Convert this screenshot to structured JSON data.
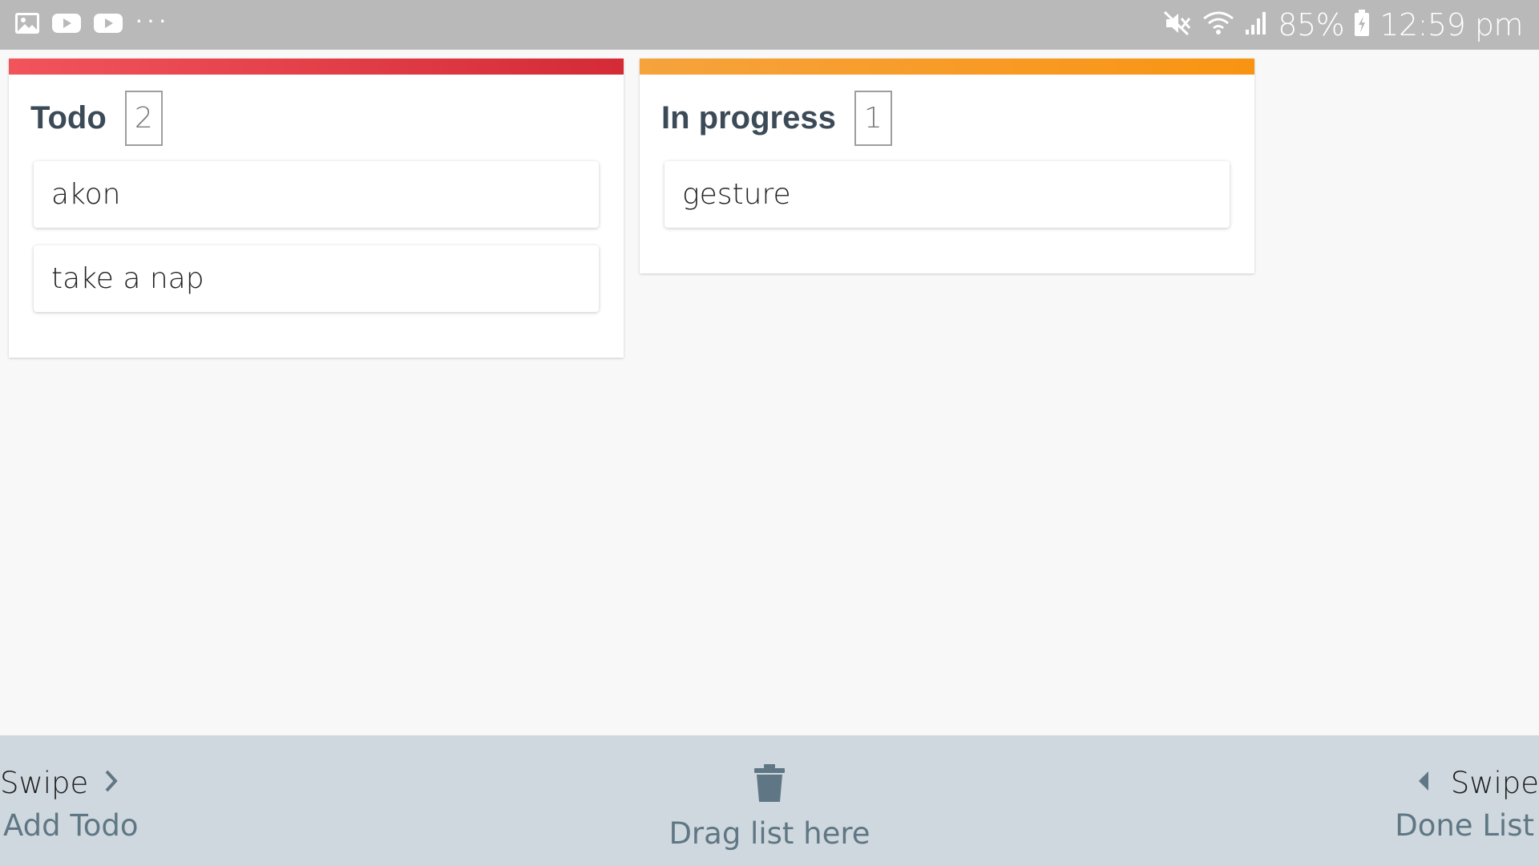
{
  "status_bar": {
    "battery": "85%",
    "time": "12:59 pm",
    "left_icons": [
      "gallery-icon",
      "youtube-icon",
      "youtube-icon",
      "more-notifications-icon"
    ],
    "right_icons": [
      "mute-icon",
      "wifi-icon",
      "signal-icon",
      "battery-charging-icon"
    ],
    "overflow_dots": "···"
  },
  "board": {
    "columns": [
      {
        "title": "Todo",
        "count": "2",
        "accent": "#e23a45",
        "cards": [
          "akon",
          "take a nap"
        ]
      },
      {
        "title": "In progress",
        "count": "1",
        "accent": "#f89a22",
        "cards": [
          "gesture"
        ]
      }
    ]
  },
  "bottom_bar": {
    "left_swipe": {
      "hint": "Swipe",
      "action": "Add Todo"
    },
    "delete_zone": {
      "label": "Drag list here",
      "icon": "trash-icon"
    },
    "right_swipe": {
      "hint": "Swipe",
      "action": "Done List"
    },
    "background": "#cfd8de",
    "label_color": "#5f7784"
  }
}
